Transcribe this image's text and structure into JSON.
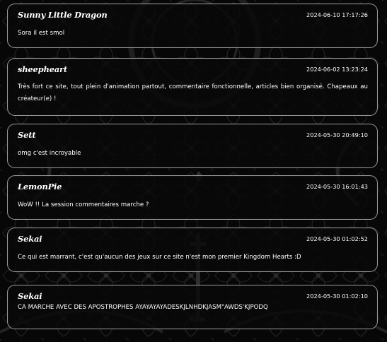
{
  "comments": [
    {
      "author": "Sunny Little Dragon",
      "timestamp": "2024-06-10 17:17:26",
      "message": "Sora il est smol"
    },
    {
      "author": "sheepheart",
      "timestamp": "2024-06-02 13:23:24",
      "message": "Très fort ce site, tout plein d'animation partout, commentaire fonctionnelle, articles bien organisé. Chapeaux au créateur(e) !"
    },
    {
      "author": "Sett",
      "timestamp": "2024-05-30 20:49:10",
      "message": "omg c'est incroyable"
    },
    {
      "author": "LemonPie",
      "timestamp": "2024-05-30 16:01:43",
      "message": "WoW !! La session commentaires marche ?"
    },
    {
      "author": "Sekai",
      "timestamp": "2024-05-30 01:02:52",
      "message": "Ce qui est marrant, c'est qu'aucun des jeux sur ce site n'est mon premier Kingdom Hearts :D"
    },
    {
      "author": "Sekai",
      "timestamp": "2024-05-30 01:02:10",
      "message": "CA MARCHE AVEC DES APOSTROPHES AYAYAYAYADESKJLNHDKJASM\"AWDS'KJPODQ"
    }
  ]
}
